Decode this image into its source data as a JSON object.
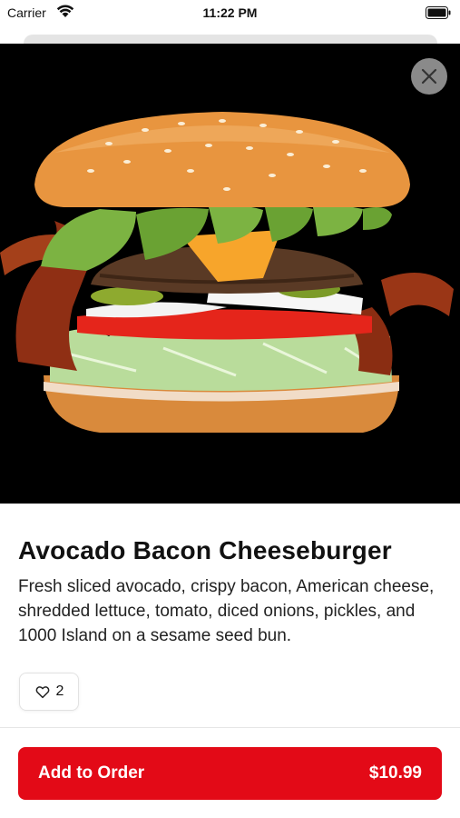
{
  "status_bar": {
    "carrier": "Carrier",
    "time": "11:22 PM"
  },
  "item": {
    "title": "Avocado Bacon Cheeseburger",
    "description": "Fresh sliced avocado, crispy bacon, American cheese, shredded lettuce, tomato, diced onions, pickles, and 1000 Island on a sesame seed bun.",
    "likes": "2",
    "image_icon": "burger-photo"
  },
  "actions": {
    "add_label": "Add to Order",
    "price": "$10.99"
  },
  "colors": {
    "accent": "#e30a17",
    "hero_bg": "#000000",
    "close_bg": "#8a8a8a"
  },
  "icons": {
    "close": "close-icon",
    "like": "heart-icon",
    "wifi": "wifi-icon",
    "battery": "battery-icon"
  }
}
